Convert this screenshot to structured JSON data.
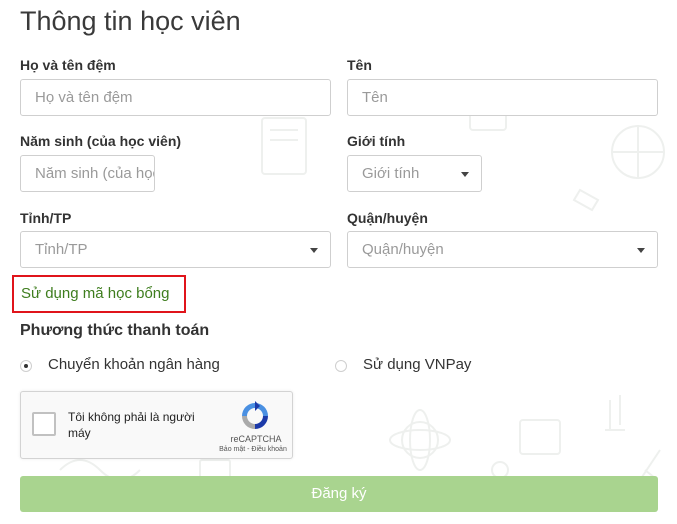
{
  "form": {
    "title": "Thông tin học viên",
    "fullname": {
      "label": "Họ và tên đệm",
      "placeholder": "Họ và tên đệm"
    },
    "firstname": {
      "label": "Tên",
      "placeholder": "Tên"
    },
    "birthyear": {
      "label": "Năm sinh (của học viên)",
      "placeholder": "Năm sinh (của học viên)"
    },
    "gender": {
      "label": "Giới tính",
      "placeholder": "Giới tính"
    },
    "province": {
      "label": "Tỉnh/TP",
      "placeholder": "Tỉnh/TP"
    },
    "district": {
      "label": "Quận/huyện",
      "placeholder": "Quận/huyện"
    },
    "scholarship_link": "Sử dụng mã học bổng",
    "payment": {
      "title": "Phương thức thanh toán",
      "options": [
        {
          "label": "Chuyển khoản ngân hàng",
          "selected": true
        },
        {
          "label": "Sử dụng VNPay",
          "selected": false
        }
      ]
    },
    "captcha": {
      "text": "Tôi không phải là người máy",
      "brand": "reCAPTCHA",
      "links": "Bảo mật - Điều khoản"
    },
    "submit_label": "Đăng ký"
  },
  "colors": {
    "scholarship_link": "#3e7d1e",
    "highlight_border": "#e0141b",
    "submit_bg": "#a9d48f"
  },
  "icons": [
    "chevron-down-icon",
    "recaptcha-logo-icon"
  ]
}
